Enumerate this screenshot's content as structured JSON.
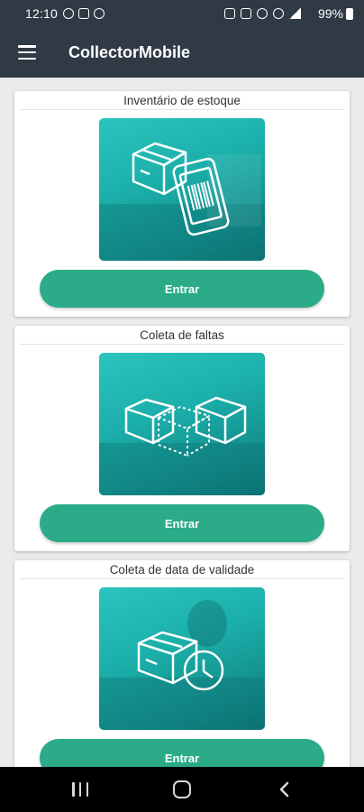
{
  "status_bar": {
    "time": "12:10",
    "battery": "99%"
  },
  "app_bar": {
    "title": "CollectorMobile"
  },
  "cards": [
    {
      "title": "Inventário de estoque",
      "button": "Entrar",
      "illustration": "boxes-and-phone-barcode-icon"
    },
    {
      "title": "Coleta de faltas",
      "button": "Entrar",
      "illustration": "missing-box-icon"
    },
    {
      "title": "Coleta de data de validade",
      "button": "Entrar",
      "illustration": "box-with-clock-icon"
    }
  ],
  "colors": {
    "app_bar": "#2f3a45",
    "button": "#2bab88",
    "image_teal": "#1cb0ab"
  }
}
